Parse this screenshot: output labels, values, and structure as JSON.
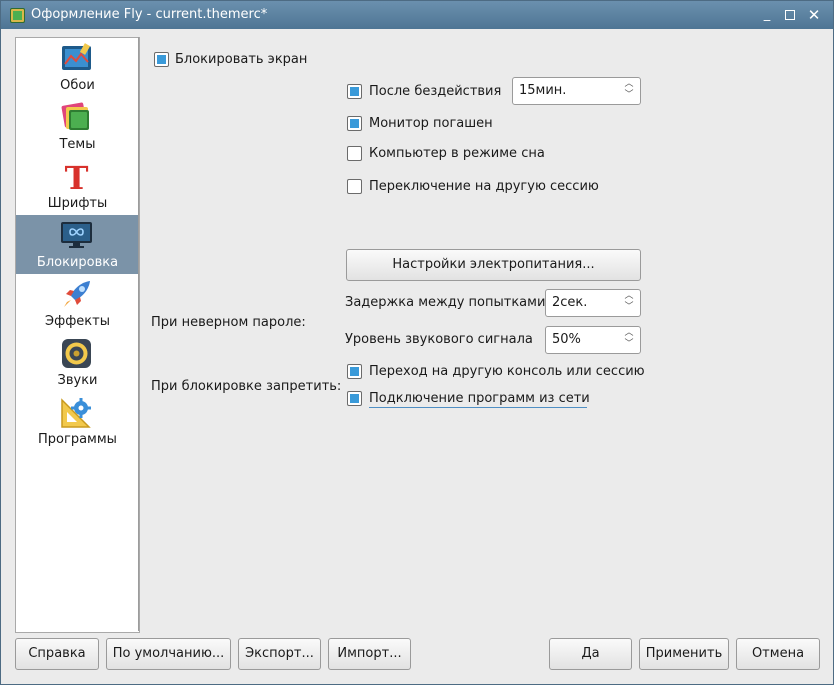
{
  "window": {
    "title": "Оформление Fly - current.themerc*"
  },
  "sidebar": {
    "items": [
      {
        "label": "Обои",
        "icon": "wallpaper-icon",
        "active": false
      },
      {
        "label": "Темы",
        "icon": "themes-icon",
        "active": false
      },
      {
        "label": "Шрифты",
        "icon": "fonts-icon",
        "active": false
      },
      {
        "label": "Блокировка",
        "icon": "lock-screen-icon",
        "active": true
      },
      {
        "label": "Эффекты",
        "icon": "effects-icon",
        "active": false
      },
      {
        "label": "Звуки",
        "icon": "sounds-icon",
        "active": false
      },
      {
        "label": "Программы",
        "icon": "programs-icon",
        "active": false
      }
    ]
  },
  "main": {
    "lock_screen": {
      "label": "Блокировать экран",
      "checked": true
    },
    "after_idle": {
      "label": "После бездействия",
      "checked": true,
      "value": "15мин."
    },
    "monitor_off": {
      "label": "Монитор погашен",
      "checked": true
    },
    "sleep_mode": {
      "label": "Компьютер в режиме сна",
      "checked": false
    },
    "switch_session": {
      "label": "Переключение на другую сессию",
      "checked": false
    },
    "power_settings_button": "Настройки электропитания...",
    "wrong_password_label": "При неверном пароле:",
    "attempt_delay": {
      "label": "Задержка между попытками",
      "value": "2сек."
    },
    "beep_level": {
      "label": "Уровень звукового сигнала",
      "value": "50%"
    },
    "forbid_label": "При блокировке запретить:",
    "forbid_console": {
      "label": "Переход на другую консоль или сессию",
      "checked": true
    },
    "forbid_network": {
      "label": "Подключение программ из сети",
      "checked": true
    }
  },
  "footer": {
    "help": "Справка",
    "defaults": "По умолчанию...",
    "export": "Экспорт...",
    "import": "Импорт...",
    "ok": "Да",
    "apply": "Применить",
    "cancel": "Отмена"
  },
  "colors": {
    "accent": "#3a9ad9",
    "titlebar": "#5a7f9e",
    "sidebar_active": "#7b93a8"
  }
}
